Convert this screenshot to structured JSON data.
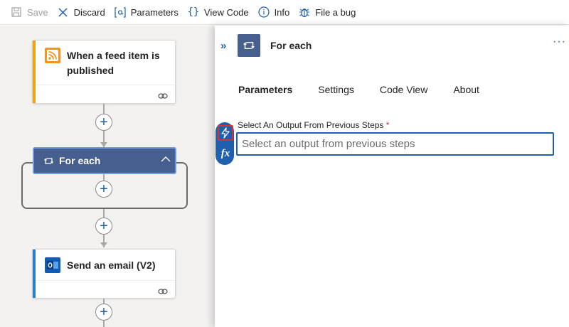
{
  "toolbar": {
    "save": "Save",
    "discard": "Discard",
    "parameters": "Parameters",
    "view_code": "View Code",
    "info": "Info",
    "file_bug": "File a bug"
  },
  "canvas": {
    "trigger_title_line1": "When a feed item is",
    "trigger_title_line2": "published",
    "foreach_title": "For each",
    "email_title": "Send an email (V2)",
    "plus_glyph": "+"
  },
  "panel": {
    "expand_glyph": "»",
    "title": "For each",
    "more_glyph": "···",
    "tabs": [
      "Parameters",
      "Settings",
      "Code View",
      "About"
    ],
    "active_tab": "Parameters",
    "field_label": "Select An Output From Previous Steps",
    "required_marker": "*",
    "field_placeholder": "Select an output from previous steps",
    "fx_label": "fx"
  },
  "colors": {
    "accent": "#1f5fad",
    "foreach": "#465f8e",
    "trigger_bar": "#f0a30a",
    "email_bar": "#2b7cd3",
    "rss": "#f7941e",
    "highlight": "#d13438"
  },
  "icons": [
    "save-icon",
    "discard-icon",
    "parameters-icon",
    "code-icon",
    "info-icon",
    "bug-icon",
    "rss-icon",
    "loop-icon",
    "outlook-icon",
    "link-icon",
    "chevron-up-icon",
    "lightning-icon",
    "fx-icon"
  ]
}
